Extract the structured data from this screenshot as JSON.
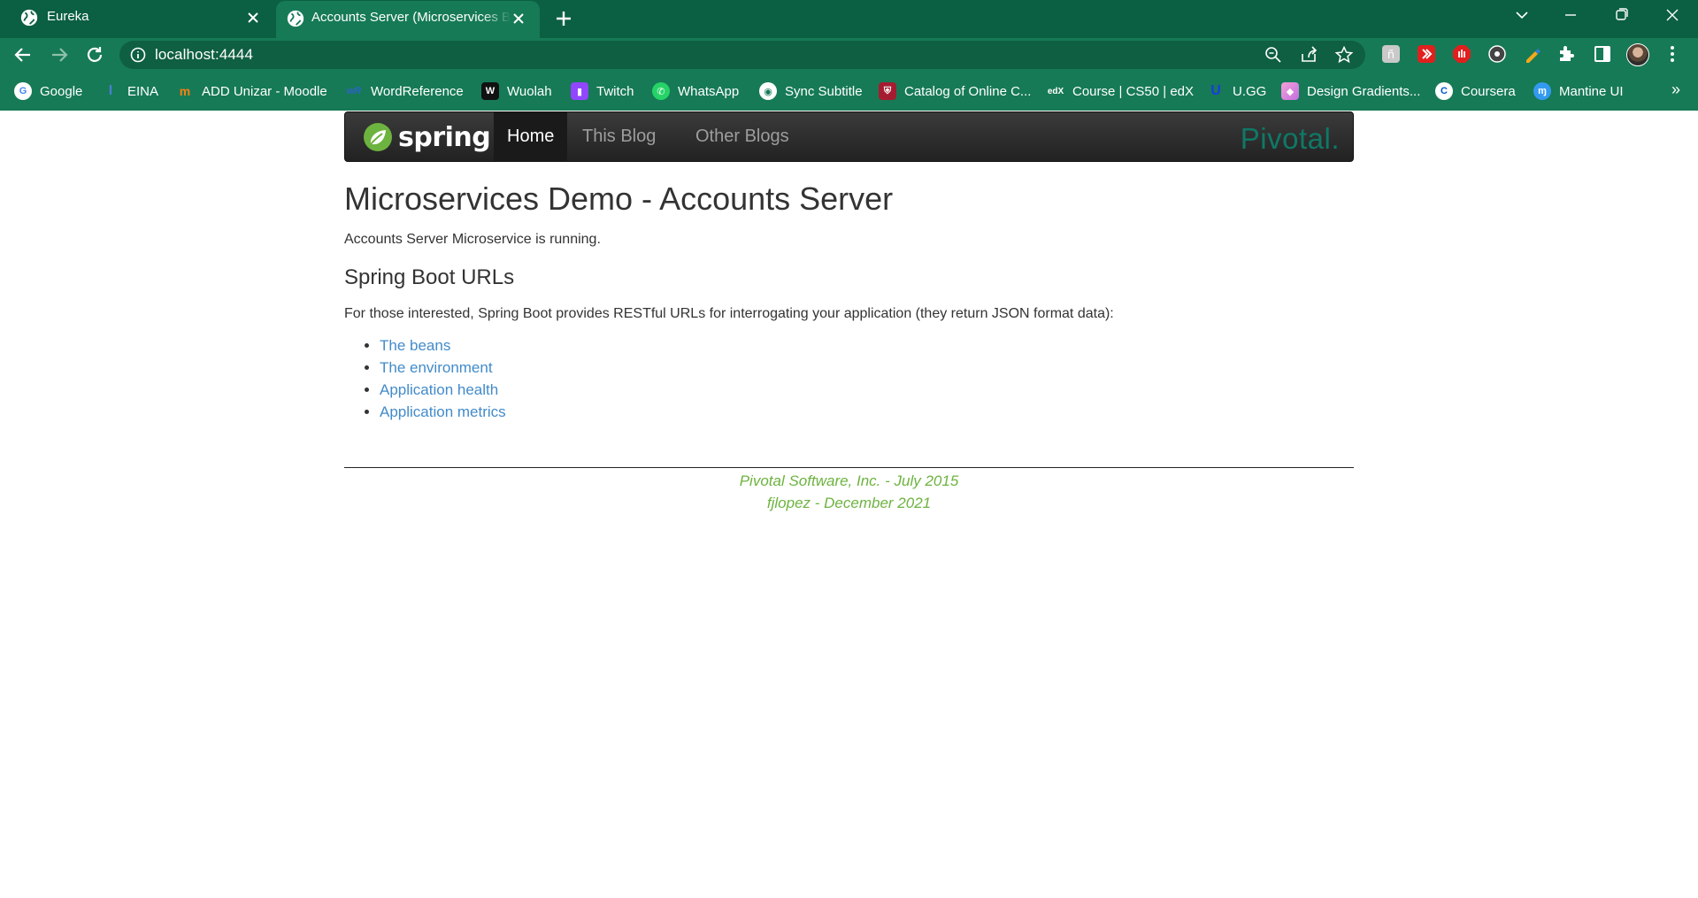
{
  "browser": {
    "tabs": [
      {
        "title": "Eureka",
        "active": false
      },
      {
        "title": "Accounts Server (Microservices Blog)",
        "active": true
      }
    ],
    "url": "localhost:4444",
    "bookmarks": [
      {
        "label": "Google",
        "icon": "google-icon"
      },
      {
        "label": "EINA",
        "icon": "eina-icon"
      },
      {
        "label": "ADD Unizar - Moodle",
        "icon": "moodle-icon"
      },
      {
        "label": "WordReference",
        "icon": "wordreference-icon"
      },
      {
        "label": "Wuolah",
        "icon": "wuolah-icon"
      },
      {
        "label": "Twitch",
        "icon": "twitch-icon"
      },
      {
        "label": "WhatsApp",
        "icon": "whatsapp-icon"
      },
      {
        "label": "Sync Subtitle",
        "icon": "globe-icon"
      },
      {
        "label": "Catalog of Online C...",
        "icon": "harvard-icon"
      },
      {
        "label": "Course | CS50 | edX",
        "icon": "edx-icon"
      },
      {
        "label": "U.GG",
        "icon": "ugg-icon"
      },
      {
        "label": "Design Gradients...",
        "icon": "gradients-icon"
      },
      {
        "label": "Coursera",
        "icon": "coursera-icon"
      },
      {
        "label": "Mantine UI",
        "icon": "mantine-icon"
      }
    ],
    "bookmarks_more": "»"
  },
  "site": {
    "brand": "spring",
    "nav": [
      {
        "label": "Home",
        "active": true
      },
      {
        "label": "This Blog",
        "active": false
      },
      {
        "label": "Other Blogs",
        "active": false
      }
    ],
    "pivotal_logo": "Pivotal."
  },
  "main": {
    "title": "Microservices Demo - Accounts Server",
    "status": "Accounts Server Microservice is running.",
    "subtitle": "Spring Boot URLs",
    "intro": "For those interested, Spring Boot provides RESTful URLs for interrogating your application (they return JSON format data):",
    "links": [
      "The beans",
      "The environment",
      "Application health",
      "Application metrics"
    ]
  },
  "footer": {
    "line1": "Pivotal Software, Inc. - July 2015",
    "line2": "fjlopez - December 2021"
  },
  "colors": {
    "chrome_dark": "#0b5f43",
    "chrome": "#167a56",
    "link": "#428bca",
    "footer": "#6db33f",
    "pivotal": "#0f7866"
  }
}
